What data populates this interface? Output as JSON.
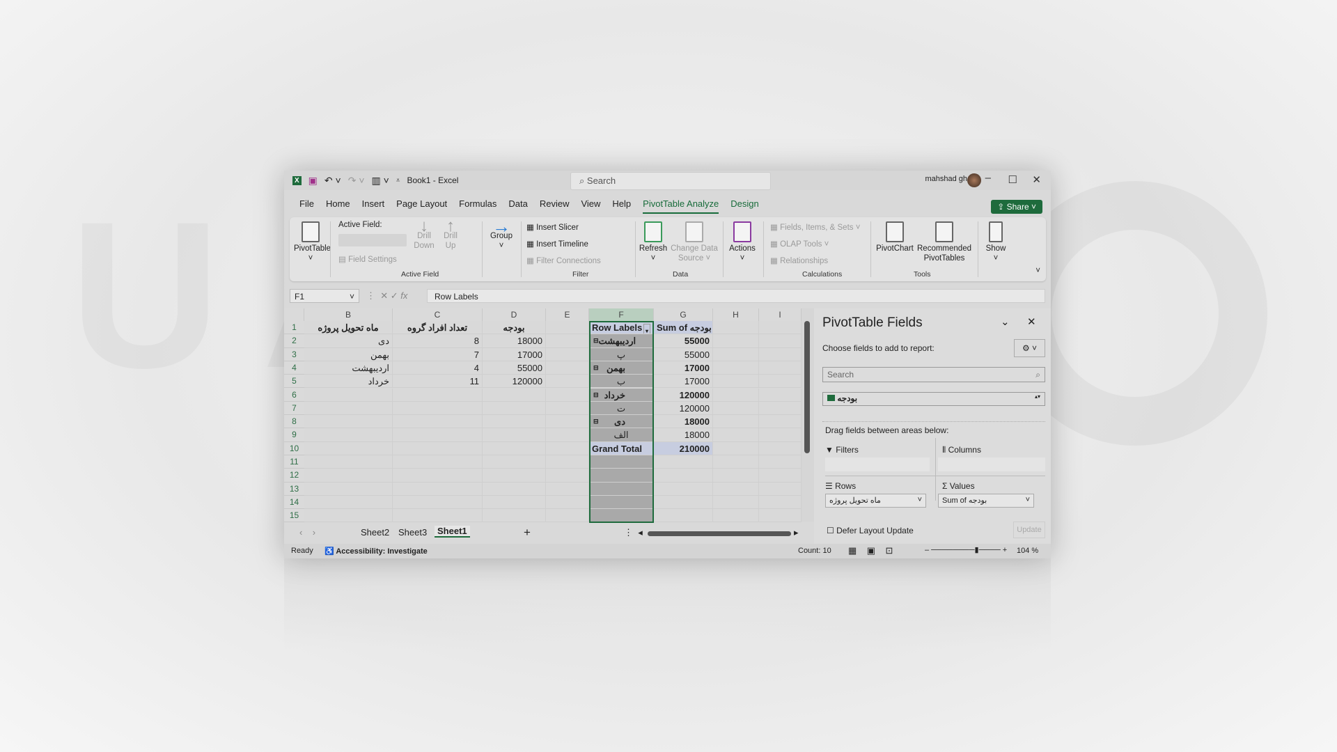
{
  "window": {
    "title": "Book1 - Excel",
    "search_placeholder": "Search",
    "user": "mahshad gh",
    "share": "Share"
  },
  "menu": [
    "File",
    "Home",
    "Insert",
    "Page Layout",
    "Formulas",
    "Data",
    "Review",
    "View",
    "Help",
    "PivotTable Analyze",
    "Design"
  ],
  "ribbon": {
    "pivottable": "PivotTable",
    "active_field_label": "Active Field:",
    "field_settings": "Field Settings",
    "drill_down": "Drill Down",
    "drill_up": "Drill Up",
    "group": "Group",
    "insert_slicer": "Insert Slicer",
    "insert_timeline": "Insert Timeline",
    "filter_connections": "Filter Connections",
    "refresh": "Refresh",
    "change_data_source": "Change Data Source",
    "actions": "Actions",
    "fields_items_sets": "Fields, Items, & Sets",
    "olap_tools": "OLAP Tools",
    "relationships": "Relationships",
    "pivotchart": "PivotChart",
    "recommended": "Recommended PivotTables",
    "show": "Show",
    "groups": {
      "active_field": "Active Field",
      "filter": "Filter",
      "data": "Data",
      "calculations": "Calculations",
      "tools": "Tools"
    }
  },
  "formula_bar": {
    "name_box": "F1",
    "formula": "Row Labels"
  },
  "columns": [
    "B",
    "C",
    "D",
    "E",
    "F",
    "G",
    "H",
    "I"
  ],
  "rows": [
    [
      "ماه تحویل پروژه",
      "تعداد افراد گروه",
      "بودجه",
      "",
      "Row Labels",
      "Sum of بودجه"
    ],
    [
      "دی",
      "8",
      "18000",
      "",
      "اردیبهشت",
      "55000"
    ],
    [
      "بهمن",
      "7",
      "17000",
      "",
      "پ",
      "55000"
    ],
    [
      "اردیبهشت",
      "4",
      "55000",
      "",
      "بهمن",
      "17000"
    ],
    [
      "خرداد",
      "11",
      "120000",
      "",
      "ب",
      "17000"
    ],
    [
      "",
      "",
      "",
      "",
      "خرداد",
      "120000"
    ],
    [
      "",
      "",
      "",
      "",
      "ت",
      "120000"
    ],
    [
      "",
      "",
      "",
      "",
      "دی",
      "18000"
    ],
    [
      "",
      "",
      "",
      "",
      "الف",
      "18000"
    ],
    [
      "",
      "",
      "",
      "",
      "Grand Total",
      "210000"
    ],
    [
      "",
      "",
      "",
      "",
      "",
      ""
    ],
    [
      "",
      "",
      "",
      "",
      "",
      ""
    ],
    [
      "",
      "",
      "",
      "",
      "",
      ""
    ],
    [
      "",
      "",
      "",
      "",
      "",
      ""
    ],
    [
      "",
      "",
      "",
      "",
      "",
      ""
    ]
  ],
  "sheets": [
    "Sheet2",
    "Sheet3",
    "Sheet1"
  ],
  "active_sheet": "Sheet1",
  "pane": {
    "title": "PivotTable Fields",
    "choose": "Choose fields to add to report:",
    "search_placeholder": "Search",
    "field": "بودجه",
    "drag": "Drag fields between areas below:",
    "filters": "Filters",
    "columns": "Columns",
    "rows": "Rows",
    "values": "Values",
    "rows_field": "ماه تحویل پروژه",
    "values_field": "Sum of بودجه",
    "defer": "Defer Layout Update",
    "update": "Update"
  },
  "status": {
    "ready": "Ready",
    "accessibility": "Accessibility: Investigate",
    "count": "Count: 10",
    "zoom": "104 %"
  },
  "colors": {
    "accent": "#1e6b3c",
    "pivot_header": "#c7cde0"
  }
}
